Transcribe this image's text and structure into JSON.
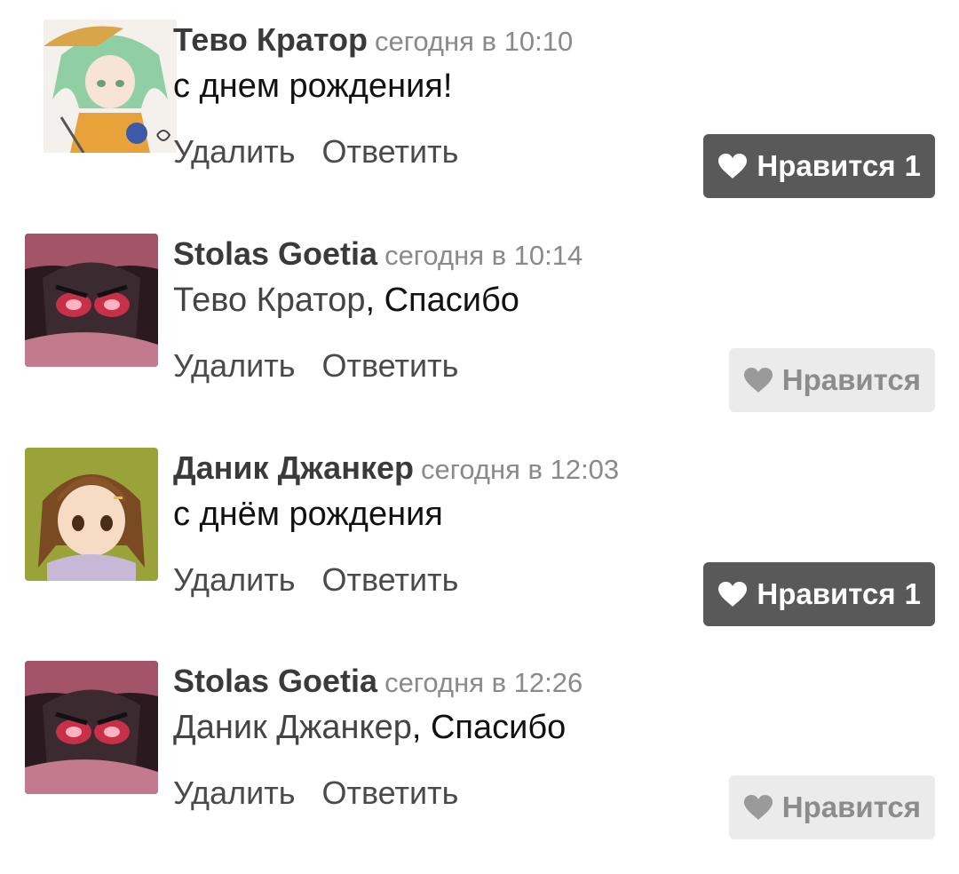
{
  "comments": [
    {
      "author": "Тево Кратор",
      "time": "сегодня в 10:10",
      "mention": "",
      "text": "с днем рождения!",
      "delete_label": "Удалить",
      "reply_label": "Ответить",
      "like_label": "Нравится",
      "like_count": "1",
      "liked": true,
      "avatar": "avatar-green-hair"
    },
    {
      "author": "Stolas Goetia",
      "time": "сегодня в 10:14",
      "mention": "Тево Кратор",
      "text": ", Спасибо",
      "delete_label": "Удалить",
      "reply_label": "Ответить",
      "like_label": "Нравится",
      "like_count": "",
      "liked": false,
      "avatar": "avatar-owl-demon"
    },
    {
      "author": "Даник Джанкер",
      "time": "сегодня в 12:03",
      "mention": "",
      "text": "с днём рождения",
      "delete_label": "Удалить",
      "reply_label": "Ответить",
      "like_label": "Нравится",
      "like_count": "1",
      "liked": true,
      "avatar": "avatar-brown-hair"
    },
    {
      "author": "Stolas Goetia",
      "time": "сегодня в 12:26",
      "mention": "Даник Джанкер",
      "text": ", Спасибо",
      "delete_label": "Удалить",
      "reply_label": "Ответить",
      "like_label": "Нравится",
      "like_count": "",
      "liked": false,
      "avatar": "avatar-owl-demon"
    }
  ],
  "colors": {
    "like_active_bg": "#595959",
    "like_inactive_bg": "#ebebeb",
    "author": "#3a3a3a",
    "time": "#8a8a8a"
  }
}
